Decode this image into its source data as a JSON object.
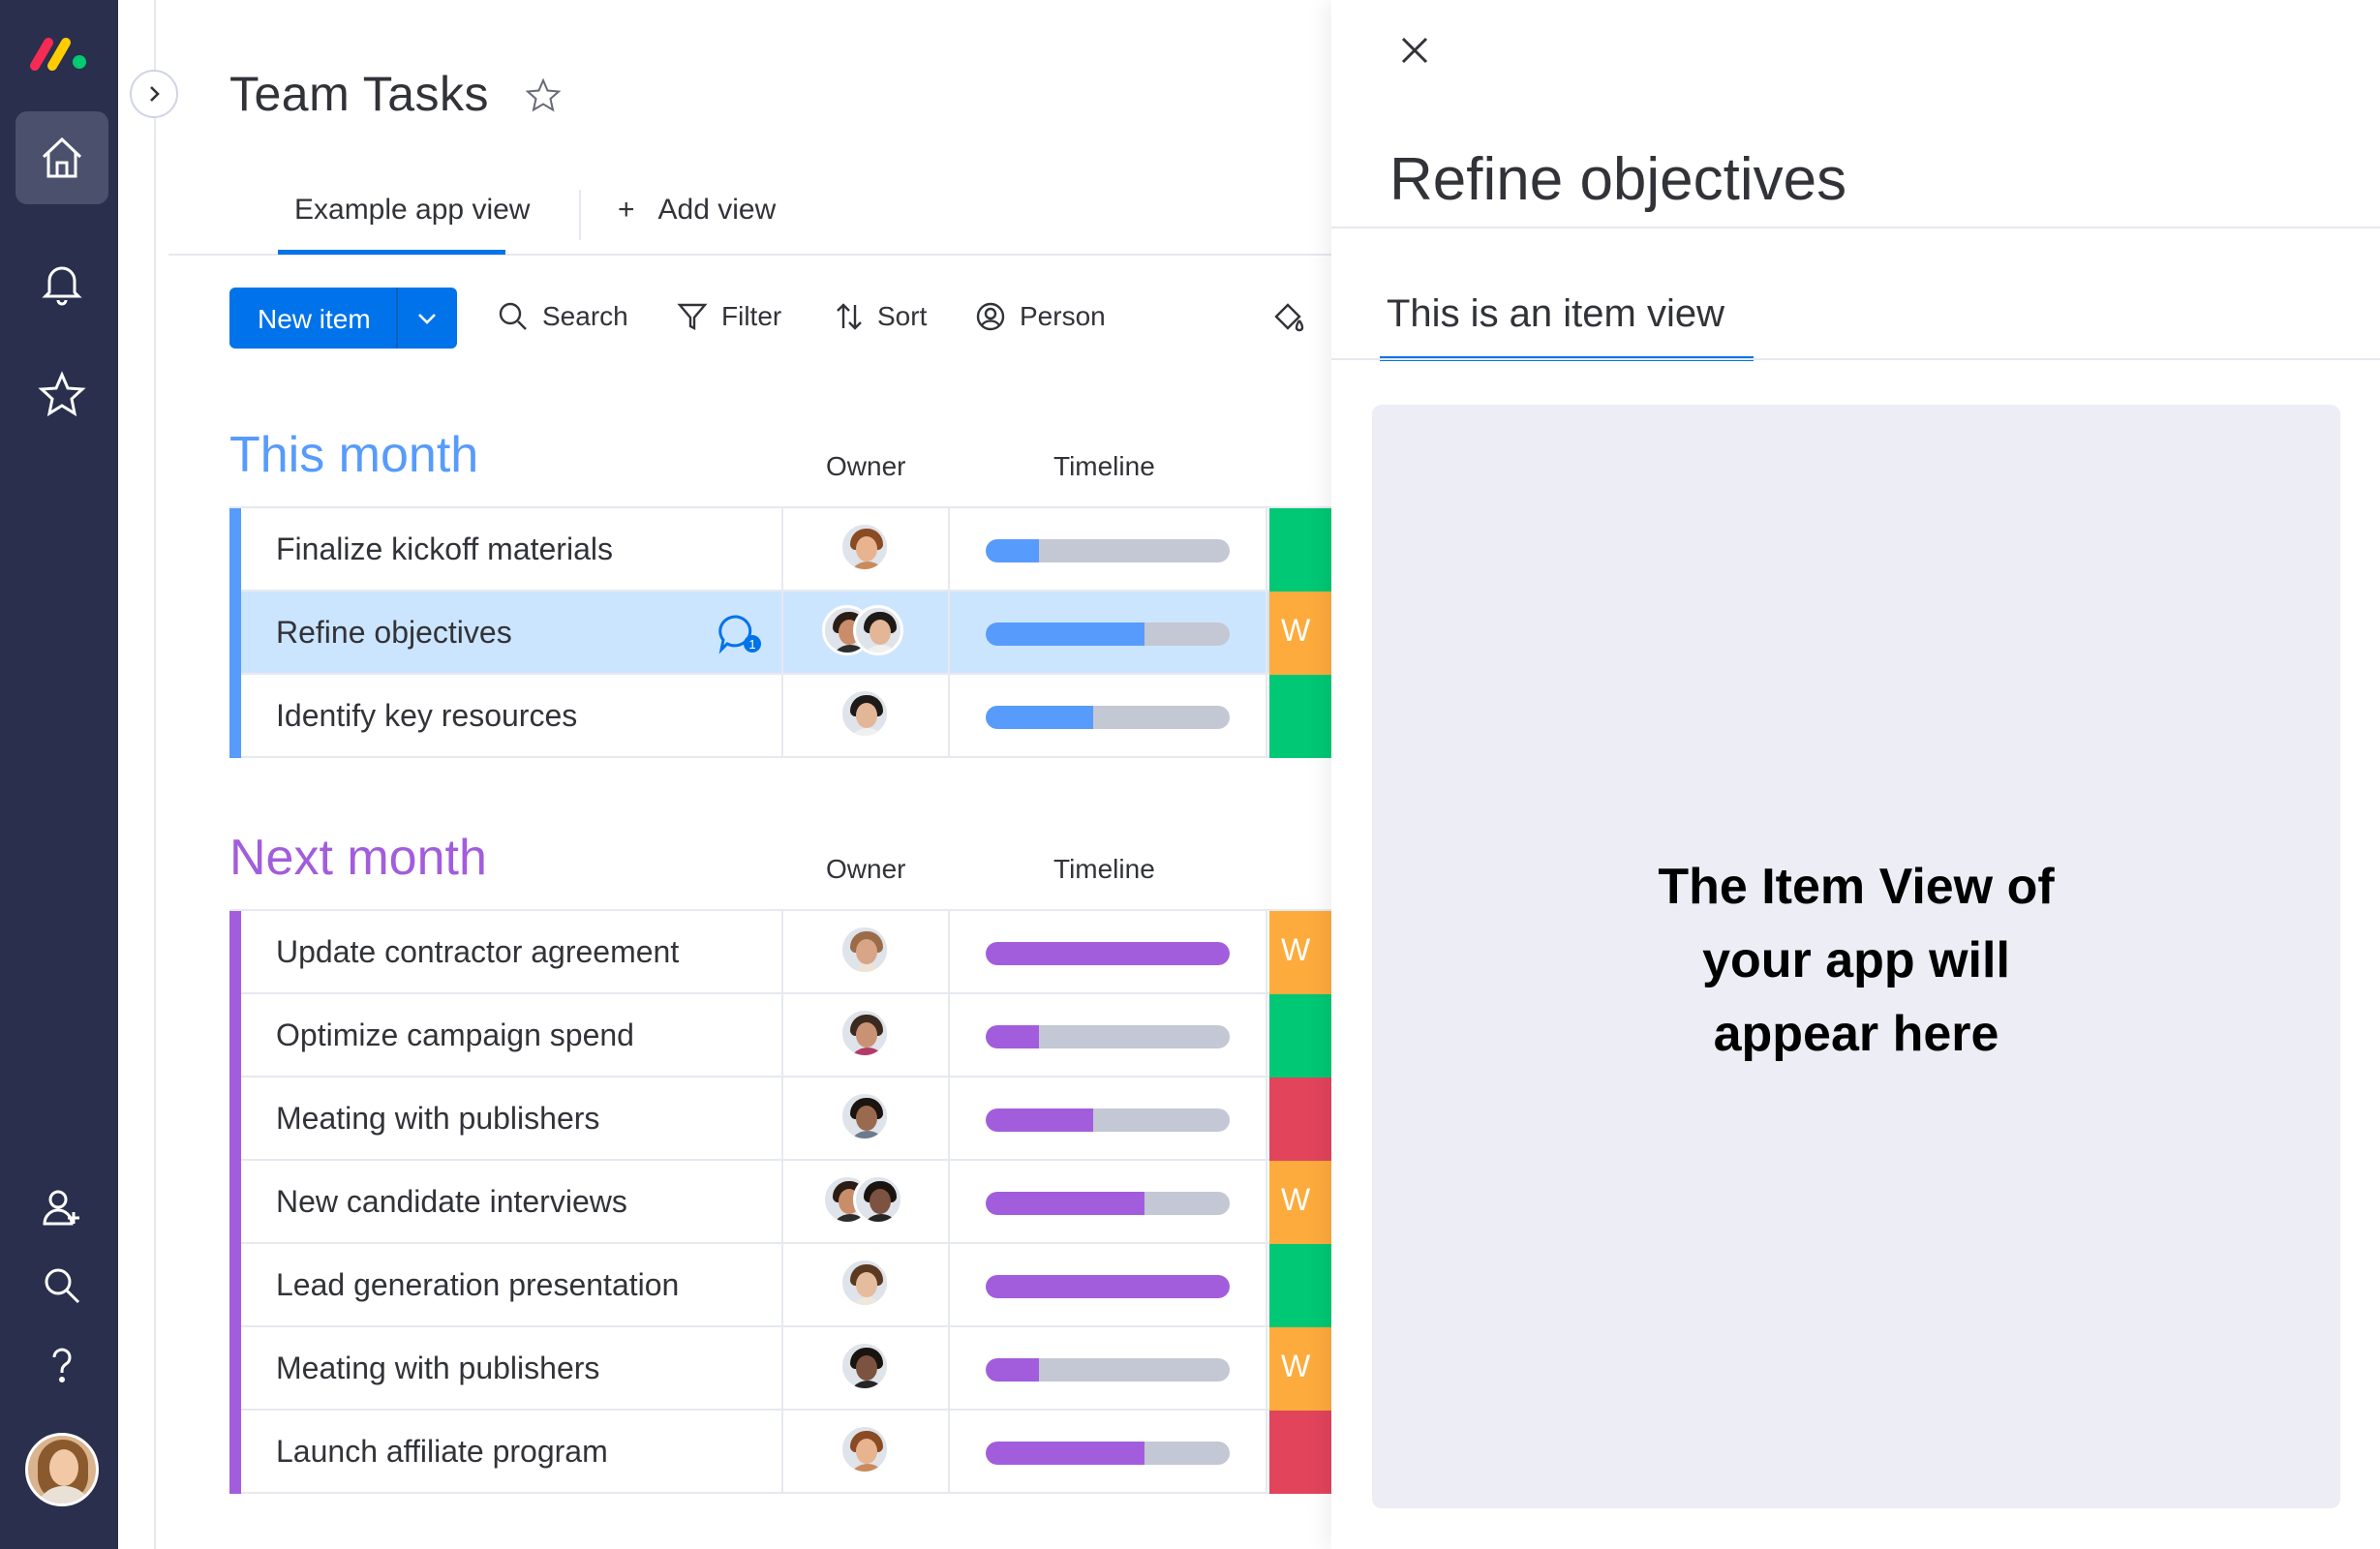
{
  "app": {
    "board_title": "Team Tasks"
  },
  "views": {
    "tabs": [
      {
        "label": "Example app view"
      },
      {
        "label": "Add view"
      }
    ]
  },
  "toolbar": {
    "new_item_label": "New item",
    "search_label": "Search",
    "filter_label": "Filter",
    "sort_label": "Sort",
    "person_label": "Person"
  },
  "columns": {
    "owner": "Owner",
    "timeline": "Timeline"
  },
  "colors": {
    "accent": "#0073ea",
    "rail": "#292f4c",
    "this_month": "#579bfc",
    "next_month": "#a25ddc",
    "done": "#00c875",
    "working": "#fdab3d",
    "stuck": "#e2445c"
  },
  "groups": [
    {
      "title": "This month",
      "color": "#579bfc",
      "rows": [
        {
          "name": "Finalize kickoff materials",
          "timeline_progress": 0.22,
          "status_color": "#00c875",
          "status_text": ""
        },
        {
          "name": "Refine objectives",
          "timeline_progress": 0.65,
          "status_color": "#fdab3d",
          "status_text": "W",
          "selected": true,
          "updates": 1
        },
        {
          "name": "Identify key resources",
          "timeline_progress": 0.44,
          "status_color": "#00c875",
          "status_text": ""
        }
      ]
    },
    {
      "title": "Next month",
      "color": "#a25ddc",
      "rows": [
        {
          "name": "Update contractor agreement",
          "timeline_progress": 1.0,
          "status_color": "#fdab3d",
          "status_text": "W"
        },
        {
          "name": "Optimize campaign spend",
          "timeline_progress": 0.22,
          "status_color": "#00c875",
          "status_text": ""
        },
        {
          "name": "Meating with publishers",
          "timeline_progress": 0.44,
          "status_color": "#e2445c",
          "status_text": ""
        },
        {
          "name": "New candidate interviews",
          "timeline_progress": 0.65,
          "status_color": "#fdab3d",
          "status_text": "W"
        },
        {
          "name": "Lead generation presentation",
          "timeline_progress": 1.0,
          "status_color": "#00c875",
          "status_text": ""
        },
        {
          "name": "Meating with publishers",
          "timeline_progress": 0.22,
          "status_color": "#fdab3d",
          "status_text": "W"
        },
        {
          "name": "Launch affiliate program",
          "timeline_progress": 0.65,
          "status_color": "#e2445c",
          "status_text": ""
        }
      ]
    }
  ],
  "item_panel": {
    "title": "Refine objectives",
    "tab_label": "This is an item view",
    "placeholder_line1": "The Item View of",
    "placeholder_line2": "your app will",
    "placeholder_line3": "appear here"
  },
  "update_badge": "1"
}
